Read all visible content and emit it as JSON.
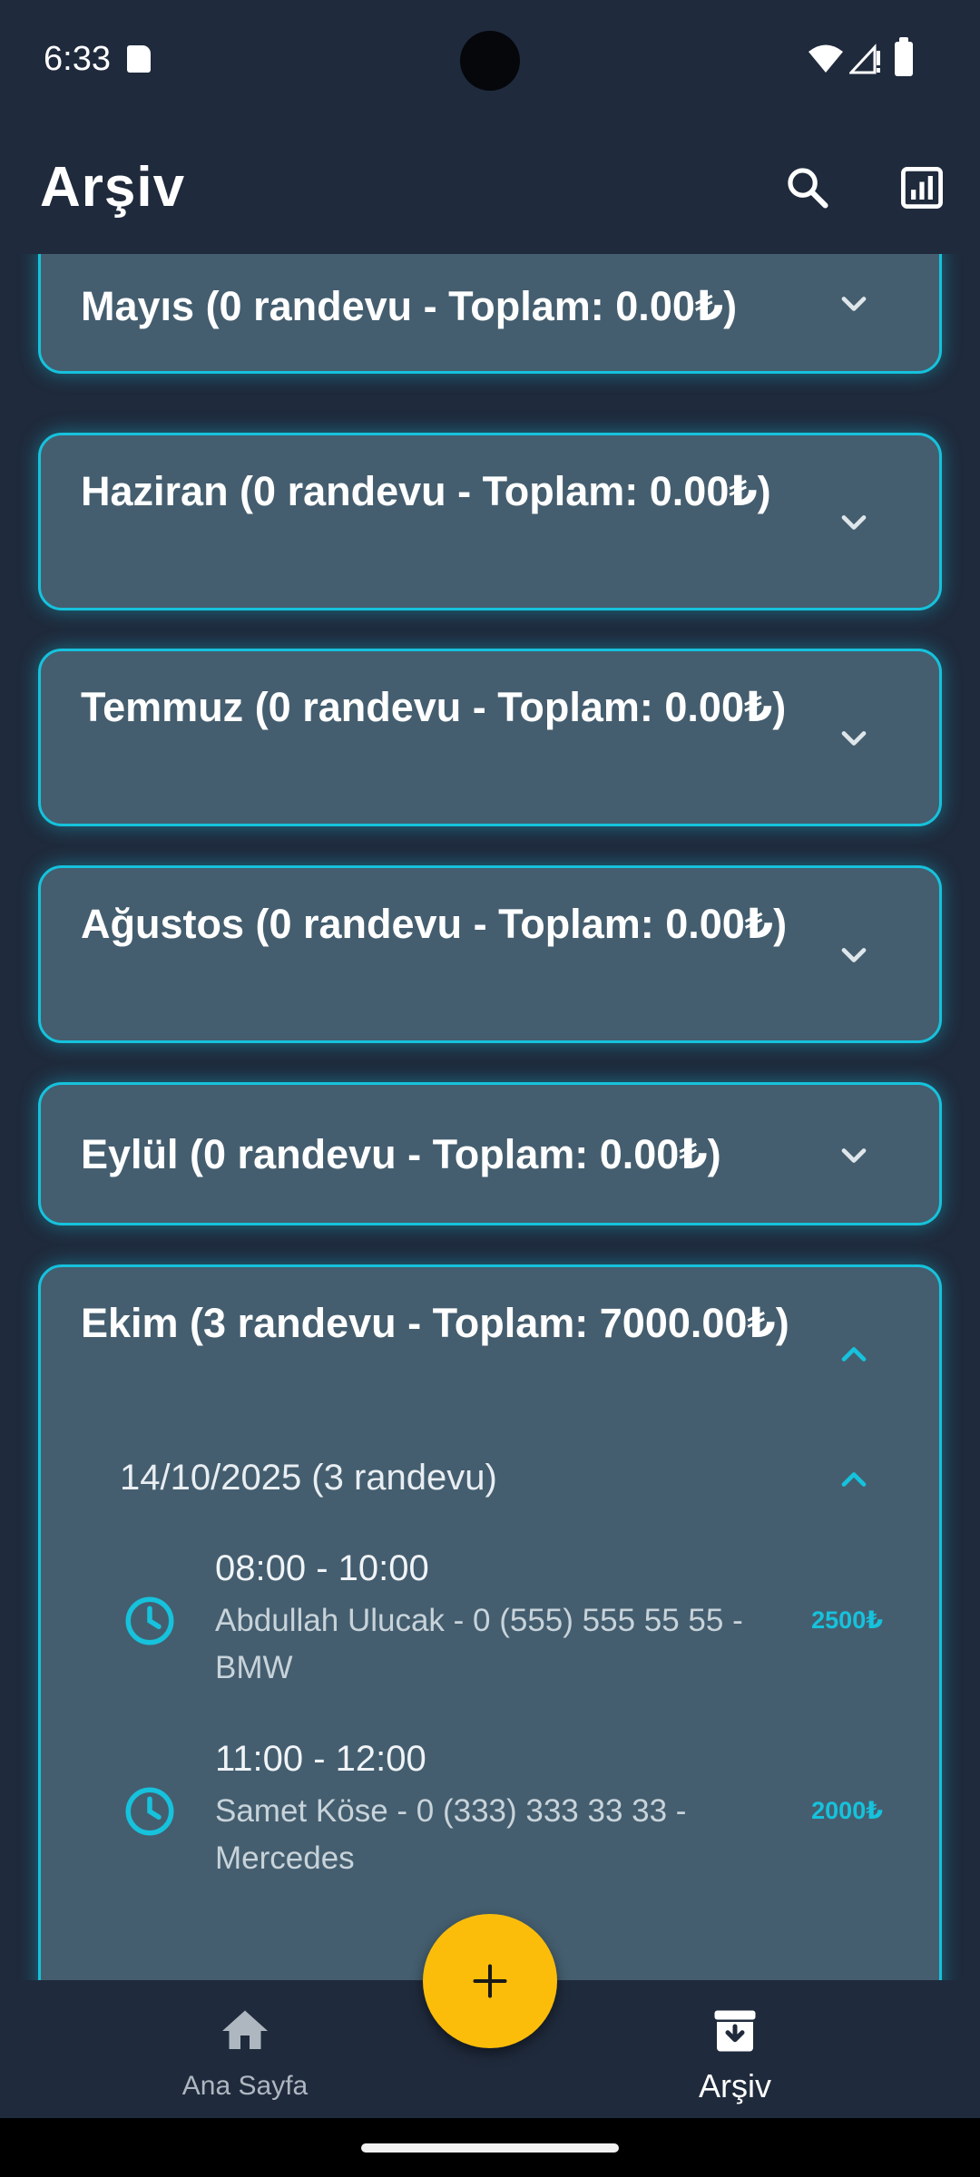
{
  "status_bar": {
    "time": "6:33"
  },
  "app_bar": {
    "title": "Arşiv"
  },
  "months": [
    {
      "title": "Mayıs (0 randevu - Toplam: 0.00₺)",
      "expanded": false
    },
    {
      "title": "Haziran (0 randevu - Toplam: 0.00₺)",
      "expanded": false
    },
    {
      "title": "Temmuz (0 randevu - Toplam: 0.00₺)",
      "expanded": false
    },
    {
      "title": "Ağustos (0 randevu - Toplam: 0.00₺)",
      "expanded": false
    },
    {
      "title": "Eylül (0 randevu - Toplam: 0.00₺)",
      "expanded": false
    },
    {
      "title": "Ekim (3 randevu - Toplam: 7000.00₺)",
      "expanded": true,
      "days": [
        {
          "label": "14/10/2025 (3 randevu)",
          "expanded": true,
          "appointments": [
            {
              "time": "08:00 - 10:00",
              "details": "Abdullah Ulucak - 0 (555) 555 55 55 - BMW",
              "price": "2500₺"
            },
            {
              "time": "11:00 - 12:00",
              "details": "Samet Köse - 0 (333) 333 33 33 - Mercedes",
              "price": "2000₺"
            }
          ]
        }
      ]
    }
  ],
  "bottom_nav": {
    "home_label": "Ana Sayfa",
    "archive_label": "Arşiv"
  },
  "colors": {
    "background": "#1f2a3c",
    "card": "#445e6f",
    "accent": "#16c2dc",
    "fab": "#fbbd0a"
  },
  "icons": {
    "search": "search-icon",
    "stats": "bar-chart-icon",
    "expand": "chevron-down-icon",
    "collapse": "chevron-up-icon",
    "clock": "clock-icon",
    "home": "home-icon",
    "archive": "archive-icon",
    "add": "plus-icon"
  }
}
